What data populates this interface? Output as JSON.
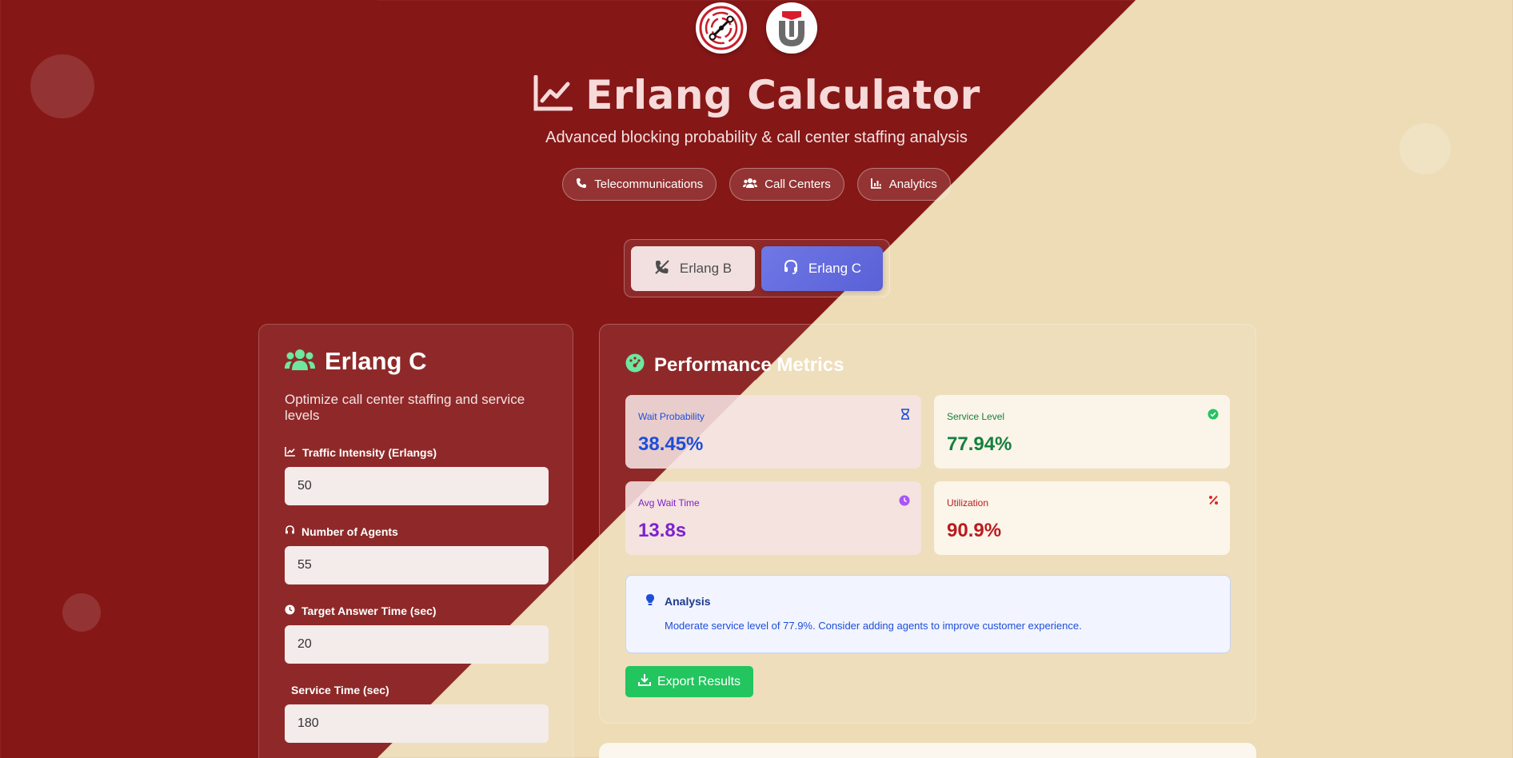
{
  "header": {
    "title": "Erlang Calculator",
    "subtitle": "Advanced blocking probability & call center staffing analysis",
    "chips": [
      {
        "label": "Telecommunications",
        "icon": "phone-icon"
      },
      {
        "label": "Call Centers",
        "icon": "users-icon"
      },
      {
        "label": "Analytics",
        "icon": "bar-chart-icon"
      }
    ]
  },
  "mode_switch": {
    "erlang_b_label": "Erlang B",
    "erlang_c_label": "Erlang C",
    "active": "Erlang C"
  },
  "input_panel": {
    "title": "Erlang C",
    "description": "Optimize call center staffing and service levels",
    "fields": [
      {
        "label": "Traffic Intensity (Erlangs)",
        "value": "50",
        "icon": "line-chart-icon"
      },
      {
        "label": "Number of Agents",
        "value": "55",
        "icon": "headset-icon"
      },
      {
        "label": "Target Answer Time (sec)",
        "value": "20",
        "icon": "clock-icon"
      },
      {
        "label": "Service Time (sec)",
        "value": "180",
        "icon": ""
      }
    ]
  },
  "metrics_panel": {
    "title": "Performance Metrics",
    "metrics": [
      {
        "label": "Wait Probability",
        "value": "38.45%",
        "icon": "hourglass-icon",
        "color": "#1d4ed8"
      },
      {
        "label": "Service Level",
        "value": "77.94%",
        "icon": "check-circle-icon",
        "color": "#15803d"
      },
      {
        "label": "Avg Wait Time",
        "value": "13.8s",
        "icon": "clock-icon",
        "color": "#7e22ce"
      },
      {
        "label": "Utilization",
        "value": "90.9%",
        "icon": "percent-icon",
        "color": "#b91c1c"
      }
    ],
    "analysis": {
      "title": "Analysis",
      "text": "Moderate service level of 77.9%. Consider adding agents to improve customer experience."
    },
    "export_label": "Export Results"
  },
  "colors": {
    "background_primary": "#861717",
    "background_secondary": "#eddcb6",
    "accent_purple": "#5a60d6",
    "accent_green": "#22c55e",
    "icon_green": "#6ee7a0"
  }
}
